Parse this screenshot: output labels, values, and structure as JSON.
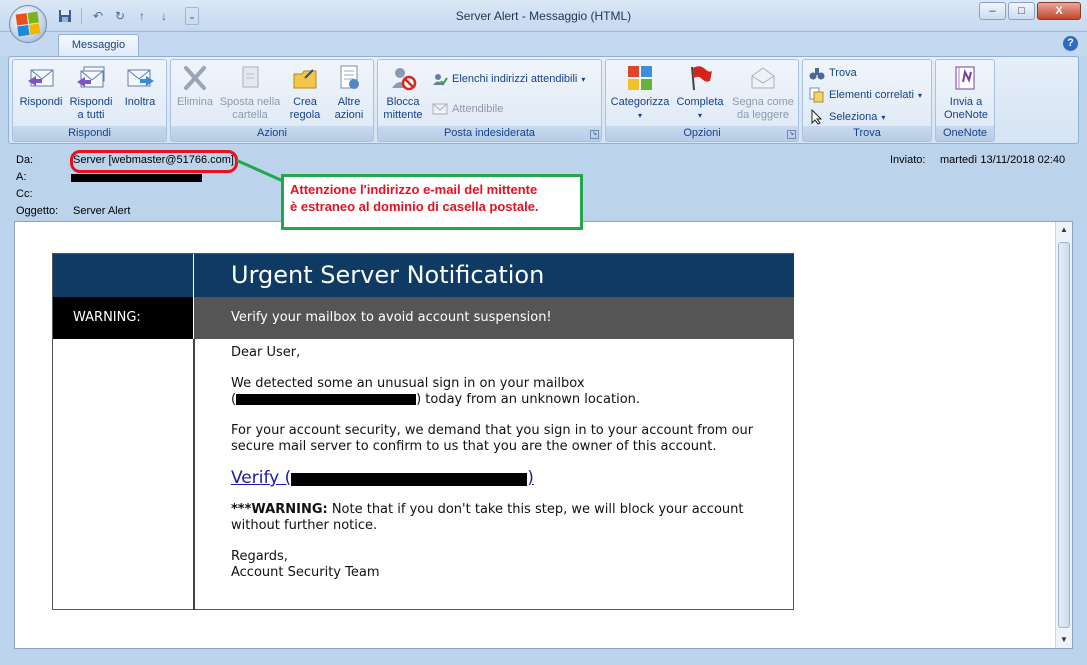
{
  "window": {
    "title": "Server Alert    - Messaggio (HTML)",
    "controls": {
      "minimize": "–",
      "maximize": "□",
      "close": "X"
    }
  },
  "quick_access": {
    "icons": [
      "save-icon",
      "undo-icon",
      "redo-icon",
      "previous-icon",
      "next-icon"
    ],
    "customize": "⌄"
  },
  "ribbon": {
    "active_tab": "Messaggio",
    "groups": {
      "rispondi": {
        "label": "Rispondi",
        "buttons": {
          "reply": "Rispondi",
          "reply_all": "Rispondi\na tutti",
          "forward": "Inoltra"
        }
      },
      "azioni": {
        "label": "Azioni",
        "buttons": {
          "delete": "Elimina",
          "move": "Sposta nella\ncartella",
          "rule": "Crea\nregola",
          "other": "Altre\nazioni"
        }
      },
      "posta_indesiderata": {
        "label": "Posta indesiderata",
        "buttons": {
          "block": "Blocca\nmittente",
          "safe_lists": "Elenchi indirizzi attendibili",
          "trusted": "Attendibile"
        }
      },
      "opzioni": {
        "label": "Opzioni",
        "buttons": {
          "categorize": "Categorizza",
          "follow_up": "Completa",
          "mark_unread": "Segna come\nda leggere"
        }
      },
      "trova": {
        "label": "Trova",
        "buttons": {
          "find": "Trova",
          "related": "Elementi correlati",
          "select": "Seleziona"
        }
      },
      "onenote": {
        "label": "OneNote",
        "buttons": {
          "send": "Invia a\nOneNote"
        }
      }
    }
  },
  "header": {
    "from_label": "Da:",
    "from_value": "Server [webmaster@51766.com]",
    "to_label": "A:",
    "cc_label": "Cc:",
    "subject_label": "Oggetto:",
    "subject_value": "Server Alert",
    "sent_label": "Inviato:",
    "sent_value": "martedì 13/11/2018 02:40"
  },
  "annotation": {
    "line1": "Attenzione l'indirizzo e-mail del mittente",
    "line2": "è estraneo al dominio di casella postale."
  },
  "email": {
    "title": "Urgent Server Notification",
    "warning_label": "WARNING:",
    "banner": "Verify your mailbox to avoid account suspension!",
    "greeting": "Dear User,",
    "p1_a": "We detected some an unusual sign in on your mailbox",
    "p1_b_open": "(",
    "p1_b_close": ") today from an unknown location.",
    "p2": "For your account security, we demand that you sign in to your account from our secure mail server to confirm to us that you are the owner of this account.",
    "verify_prefix": "Verify (",
    "verify_suffix": ")",
    "warning_bold": "***WARNING:",
    "warning_text": " Note that if you don't take this step, we will block your account without further notice.",
    "regards": "Regards,",
    "signature": "Account Security Team"
  }
}
